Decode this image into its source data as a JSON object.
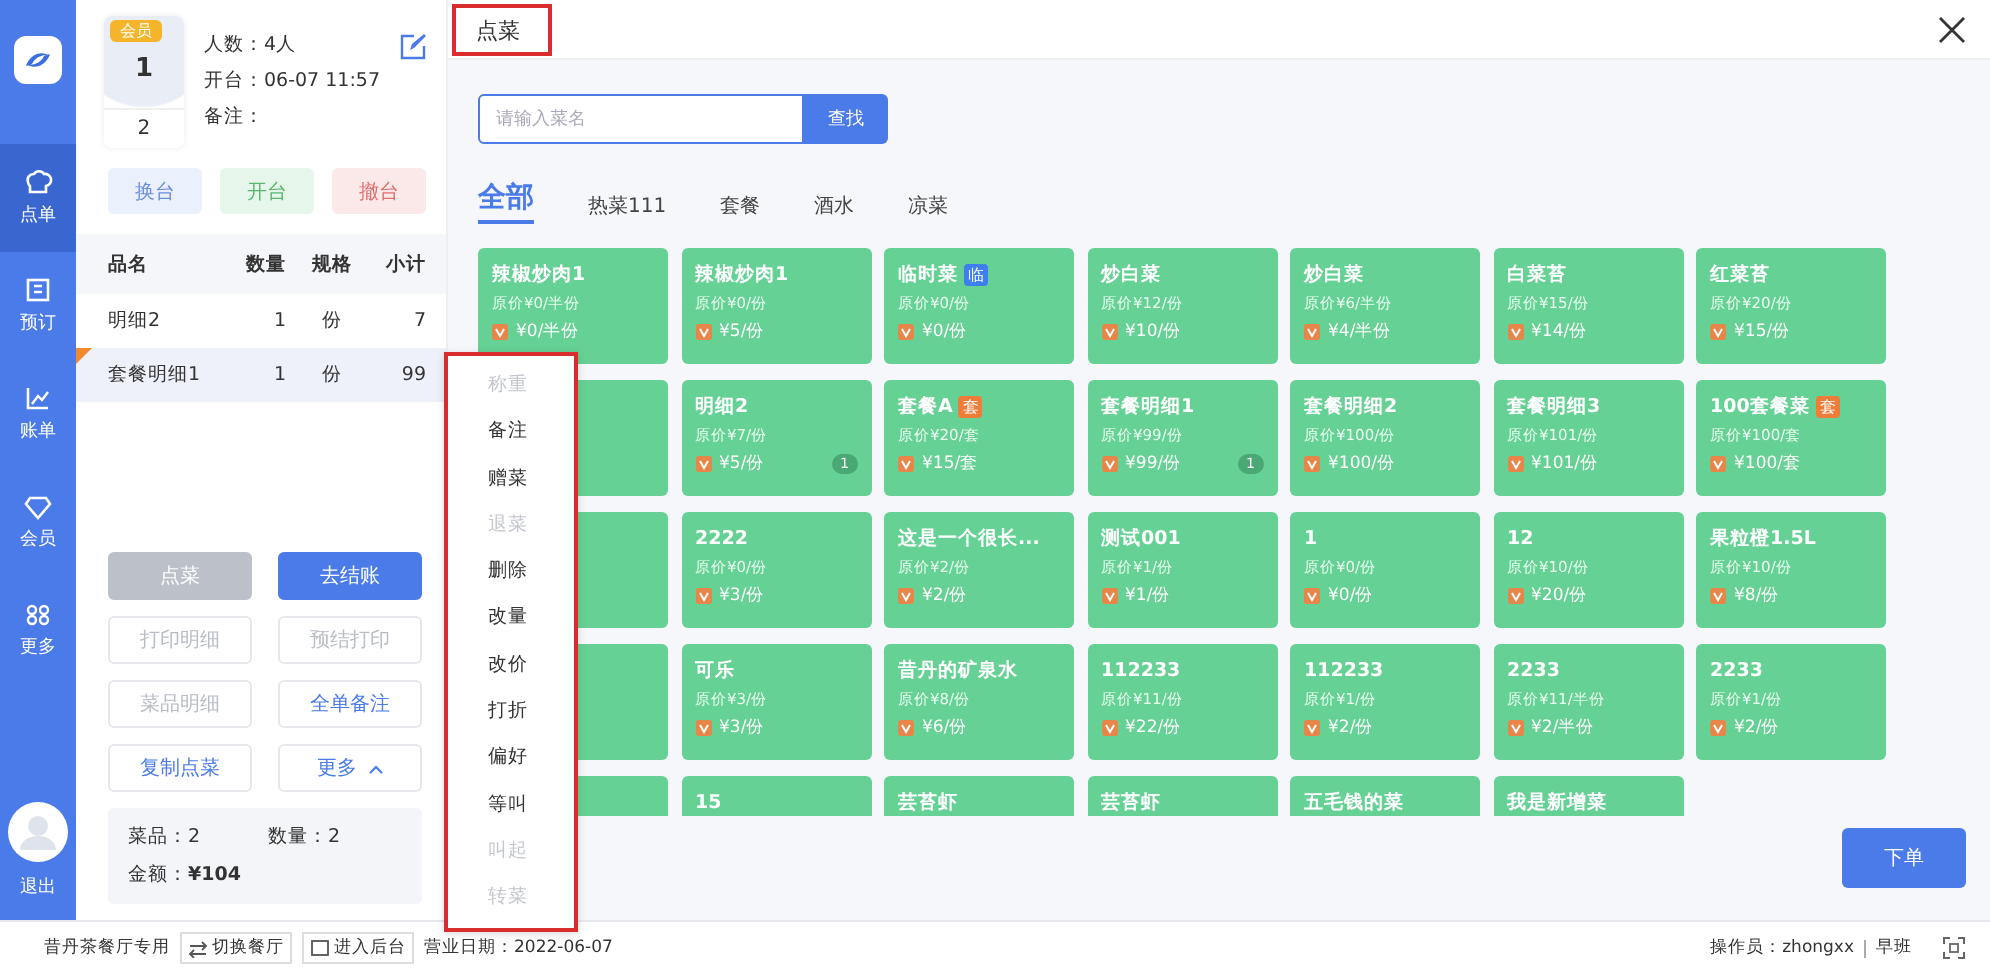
{
  "sidebar": {
    "items": [
      {
        "label": "点单",
        "kind": "chef",
        "selected": true
      },
      {
        "label": "预订",
        "kind": "book",
        "selected": false
      },
      {
        "label": "账单",
        "kind": "chart",
        "selected": false
      },
      {
        "label": "会员",
        "kind": "diamond",
        "selected": false
      },
      {
        "label": "更多",
        "kind": "grid",
        "selected": false
      }
    ],
    "logout": "退出"
  },
  "table_card": {
    "badge": "会员",
    "table_no": "1",
    "seat": "2",
    "info": [
      "人数：4人",
      "开台：06-07 11:57",
      "备注："
    ]
  },
  "table_actions": [
    {
      "label": "换台",
      "kind": "blue"
    },
    {
      "label": "开台",
      "kind": "green"
    },
    {
      "label": "撤台",
      "kind": "red"
    }
  ],
  "order": {
    "columns": [
      "品名",
      "数量",
      "规格",
      "小计"
    ],
    "rows": [
      {
        "cells": [
          "明细2",
          "1",
          "份",
          "7"
        ],
        "selected": false
      },
      {
        "cells": [
          "套餐明细1",
          "1",
          "份",
          "99"
        ],
        "selected": true
      }
    ]
  },
  "actions": [
    {
      "label": "点菜",
      "kind": "filled",
      "disabled": true
    },
    {
      "label": "去结账",
      "kind": "filled",
      "disabled": false
    },
    {
      "label": "打印明细",
      "kind": "outline",
      "disabled": true
    },
    {
      "label": "预结打印",
      "kind": "outline",
      "disabled": true
    },
    {
      "label": "菜品明细",
      "kind": "outline",
      "disabled": true
    },
    {
      "label": "全单备注",
      "kind": "outline",
      "disabled": false
    },
    {
      "label": "复制点菜",
      "kind": "outline",
      "disabled": false
    },
    {
      "label": "更多",
      "kind": "menu",
      "disabled": false,
      "expanded": true
    }
  ],
  "summary": {
    "dishes": "菜品：2",
    "quantity": "数量：2",
    "amount": "金额：**¥104**"
  },
  "context_menu": {
    "items": [
      {
        "label": "称重",
        "disabled": true
      },
      {
        "label": "备注",
        "disabled": false
      },
      {
        "label": "赠菜",
        "disabled": false
      },
      {
        "label": "退菜",
        "disabled": true
      },
      {
        "label": "删除",
        "disabled": false
      },
      {
        "label": "改量",
        "disabled": false
      },
      {
        "label": "改价",
        "disabled": false
      },
      {
        "label": "打折",
        "disabled": false
      },
      {
        "label": "偏好",
        "disabled": false
      },
      {
        "label": "等叫",
        "disabled": false
      },
      {
        "label": "叫起",
        "disabled": true
      },
      {
        "label": "转菜",
        "disabled": true
      }
    ]
  },
  "dialog": {
    "title": "点菜",
    "search": {
      "placeholder": "请输入菜名",
      "button": "查找"
    },
    "categories": [
      {
        "label": "全部",
        "selected": true
      },
      {
        "label": "热菜111",
        "selected": false
      },
      {
        "label": "套餐",
        "selected": false
      },
      {
        "label": "酒水",
        "selected": false
      },
      {
        "label": "凉菜",
        "selected": false
      }
    ],
    "dishes": [
      {
        "kind": "dish",
        "name": "辣椒炒肉1",
        "original": "原价¥0/半份",
        "price": "¥0/半份"
      },
      {
        "kind": "dish",
        "name": "辣椒炒肉1",
        "original": "原价¥0/份",
        "price": "¥5/份"
      },
      {
        "kind": "dish",
        "name": "临时菜",
        "tag": {
          "text": "临",
          "color": "#3d7ef0"
        },
        "original": "原价¥0/份",
        "price": "¥0/份"
      },
      {
        "kind": "dish",
        "name": "炒白菜",
        "original": "原价¥12/份",
        "price": "¥10/份"
      },
      {
        "kind": "dish",
        "name": "炒白菜",
        "original": "原价¥6/半份",
        "price": "¥4/半份"
      },
      {
        "kind": "dish",
        "name": "白菜苔",
        "original": "原价¥15/份",
        "price": "¥14/份"
      },
      {
        "kind": "dish",
        "name": "红菜苔",
        "original": "原价¥20/份",
        "price": "¥15/份"
      },
      {
        "kind": "covered"
      },
      {
        "kind": "dish",
        "name": "明细2",
        "original": "原价¥7/份",
        "price": "¥5/份",
        "count": "1"
      },
      {
        "kind": "dish",
        "name": "套餐A",
        "tag": {
          "text": "套",
          "color": "#f07c3a"
        },
        "original": "原价¥20/套",
        "price": "¥15/套"
      },
      {
        "kind": "dish",
        "name": "套餐明细1",
        "original": "原价¥99/份",
        "price": "¥99/份",
        "count": "1"
      },
      {
        "kind": "dish",
        "name": "套餐明细2",
        "original": "原价¥100/份",
        "price": "¥100/份"
      },
      {
        "kind": "dish",
        "name": "套餐明细3",
        "original": "原价¥101/份",
        "price": "¥101/份"
      },
      {
        "kind": "dish",
        "name": "100套餐菜",
        "tag": {
          "text": "套",
          "color": "#f07c3a"
        },
        "original": "原价¥100/套",
        "price": "¥100/套"
      },
      {
        "kind": "covered"
      },
      {
        "kind": "dish",
        "name": "2222",
        "original": "原价¥0/份",
        "price": "¥3/份"
      },
      {
        "kind": "dish",
        "name": "这是一个很长...",
        "original": "原价¥2/份",
        "price": "¥2/份"
      },
      {
        "kind": "dish",
        "name": "测试001",
        "original": "原价¥1/份",
        "price": "¥1/份"
      },
      {
        "kind": "dish",
        "name": "1",
        "original": "原价¥0/份",
        "price": "¥0/份"
      },
      {
        "kind": "dish",
        "name": "12",
        "original": "原价¥10/份",
        "price": "¥20/份"
      },
      {
        "kind": "dish",
        "name": "果粒橙1.5L",
        "original": "原价¥10/份",
        "price": "¥8/份"
      },
      {
        "kind": "covered"
      },
      {
        "kind": "dish",
        "name": "可乐",
        "original": "原价¥3/份",
        "price": "¥3/份"
      },
      {
        "kind": "dish",
        "name": "昔丹的矿泉水",
        "original": "原价¥8/份",
        "price": "¥6/份"
      },
      {
        "kind": "dish",
        "name": "112233",
        "original": "原价¥11/份",
        "price": "¥22/份"
      },
      {
        "kind": "dish",
        "name": "112233",
        "original": "原价¥1/份",
        "price": "¥2/份"
      },
      {
        "kind": "dish",
        "name": "2233",
        "original": "原价¥11/半份",
        "price": "¥2/半份"
      },
      {
        "kind": "dish",
        "name": "2233",
        "original": "原价¥1/份",
        "price": "¥2/份"
      },
      {
        "kind": "covered"
      },
      {
        "kind": "dish",
        "name": "15"
      },
      {
        "kind": "dish",
        "name": "芸苔虾"
      },
      {
        "kind": "dish",
        "name": "芸苔虾"
      },
      {
        "kind": "dish",
        "name": "五毛钱的菜"
      },
      {
        "kind": "dish",
        "name": "我是新增菜"
      }
    ],
    "submit": "下单"
  },
  "status_bar": {
    "store": "昔丹茶餐厅专用",
    "buttons": [
      {
        "label": "切换餐厅",
        "kind": "swap"
      },
      {
        "label": "进入后台",
        "kind": "box"
      }
    ],
    "business_date": "营业日期：2022-06-07",
    "operator": "操作员：zhongxx",
    "shift": "早班"
  }
}
